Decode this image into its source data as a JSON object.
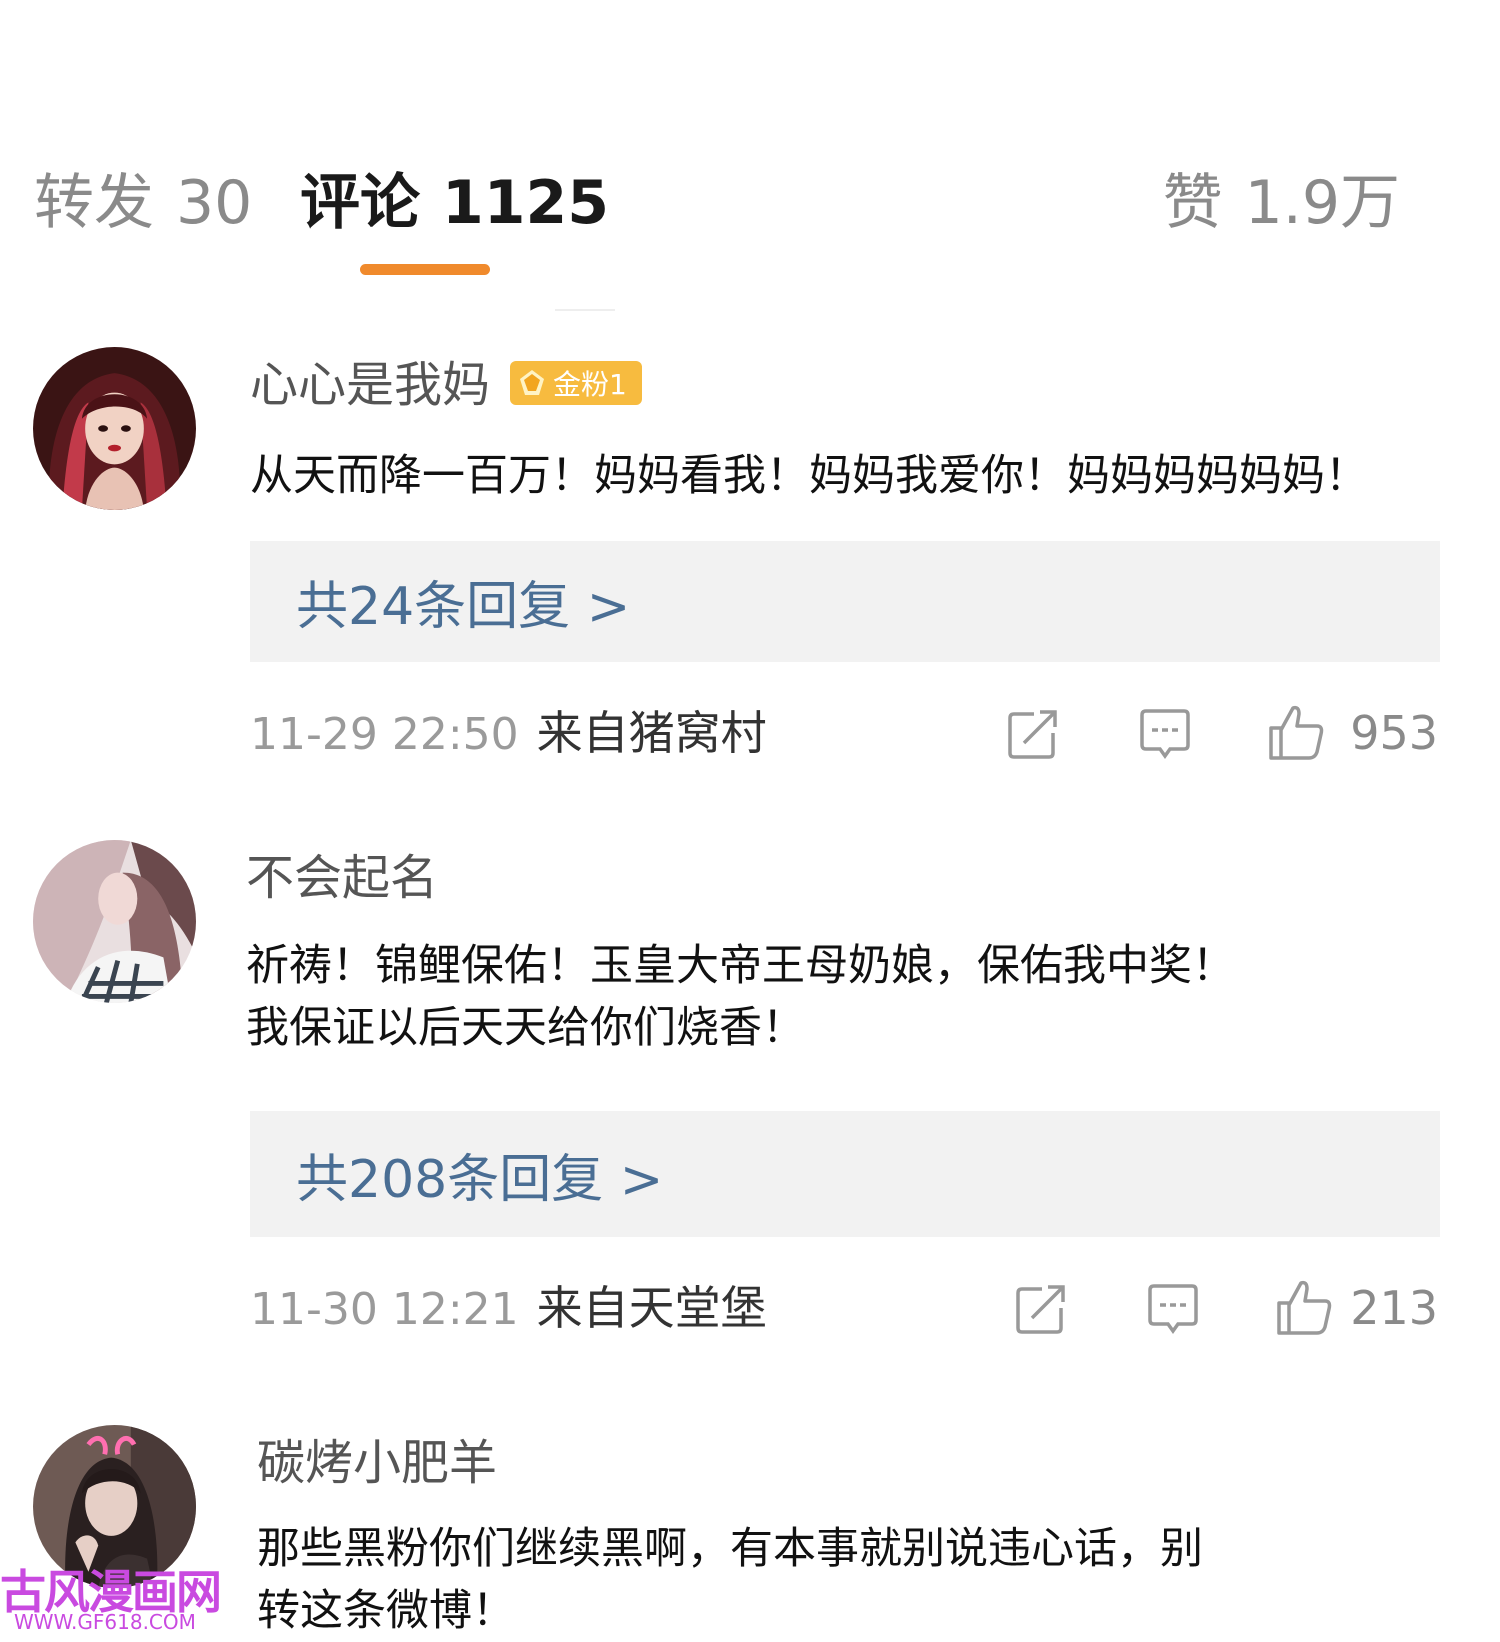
{
  "tabs": {
    "repost": {
      "label": "转发",
      "count": "30"
    },
    "comments": {
      "label": "评论",
      "count": "1125"
    },
    "likes": {
      "label": "赞",
      "count": "1.9万"
    }
  },
  "accent_color": "#f08a2c",
  "reply_link_color": "#4a6e94",
  "comments": [
    {
      "username": "心心是我妈",
      "badge": "金粉1",
      "text": "从天而降一百万！妈妈看我！妈妈我爱你！妈妈妈妈妈妈！",
      "replies": "共24条回复 >",
      "time": "11-29 22:50",
      "source": "来自猪窝村",
      "likes": "953"
    },
    {
      "username": "不会起名",
      "text_lines": [
        "祈祷！锦鲤保佑！玉皇大帝王母奶娘，保佑我中奖！",
        "我保证以后天天给你们烧香！"
      ],
      "replies": "共208条回复 >",
      "time": "11-30 12:21",
      "source": "来自天堂堡",
      "likes": "213"
    },
    {
      "username": "碳烤小肥羊",
      "text_lines": [
        "那些黑粉你们继续黑啊，有本事就别说违心话，别",
        "转这条微博！"
      ]
    }
  ],
  "icons": [
    "share-icon",
    "comment-icon",
    "thumbs-up-icon",
    "gem-icon"
  ],
  "watermark": {
    "logo": "古风漫画网",
    "url": "WWW.GF618.COM"
  }
}
